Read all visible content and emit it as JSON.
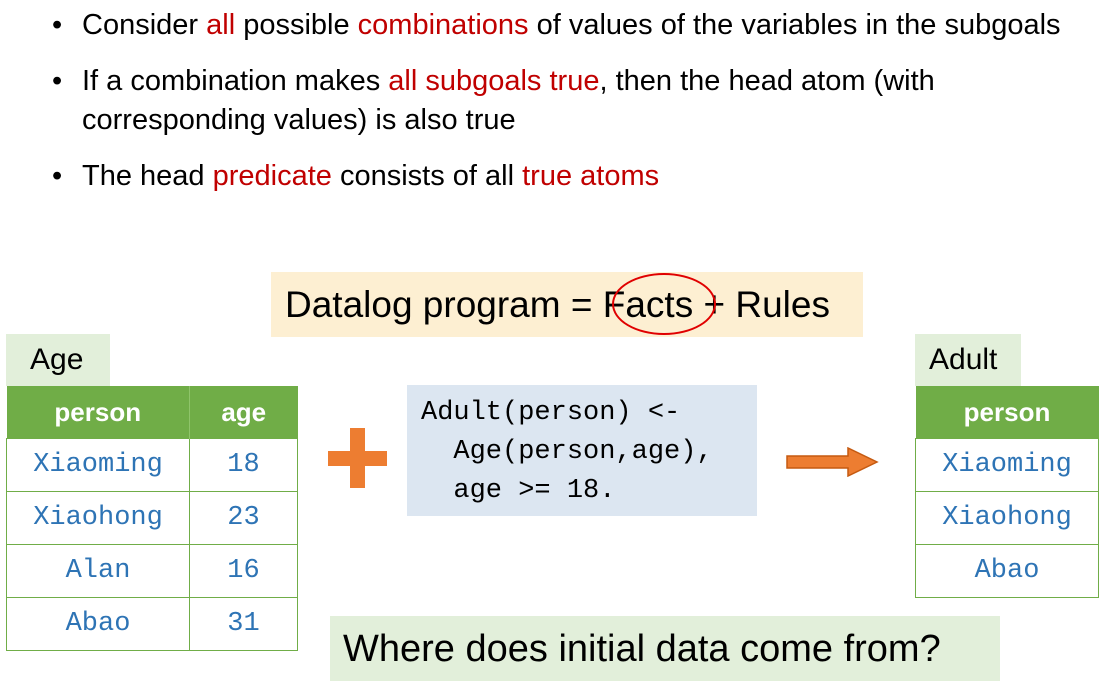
{
  "bullets": [
    [
      {
        "t": "Consider ",
        "red": false
      },
      {
        "t": "all",
        "red": true
      },
      {
        "t": " possible ",
        "red": false
      },
      {
        "t": "combinations",
        "red": true
      },
      {
        "t": " of values of the variables in the subgoals",
        "red": false
      }
    ],
    [
      {
        "t": "If a combination makes ",
        "red": false
      },
      {
        "t": "all subgoals true",
        "red": true
      },
      {
        "t": ", then the head atom (with corresponding values) is also true",
        "red": false
      }
    ],
    [
      {
        "t": "The head ",
        "red": false
      },
      {
        "t": "predicate",
        "red": true
      },
      {
        "t": " consists of all ",
        "red": false
      },
      {
        "t": "true atoms",
        "red": true
      }
    ]
  ],
  "banner": {
    "text": "Datalog program = Facts + Rules"
  },
  "age_table": {
    "title": "Age",
    "headers": [
      "person",
      "age"
    ],
    "rows": [
      [
        "Xiaoming",
        "18"
      ],
      [
        "Xiaohong",
        "23"
      ],
      [
        "Alan",
        "16"
      ],
      [
        "Abao",
        "31"
      ]
    ]
  },
  "rule": {
    "code": "Adult(person) <-\n  Age(person,age),\n  age >= 18."
  },
  "adult_table": {
    "title": "Adult",
    "headers": [
      "person"
    ],
    "rows": [
      [
        "Xiaoming"
      ],
      [
        "Xiaohong"
      ],
      [
        "Abao"
      ]
    ]
  },
  "question": "Where does initial data come from?",
  "colors": {
    "accent_red": "#c00000",
    "table_green": "#70ad47",
    "cell_blue": "#2e74b5",
    "arrow_orange": "#ed7d31",
    "banner_bg": "#fdefd2",
    "tag_bg": "#e2efda",
    "rule_bg": "#dce6f1"
  },
  "icons": {
    "plus": "plus-icon",
    "arrow": "arrow-right-icon",
    "circle": "highlight-circle"
  }
}
